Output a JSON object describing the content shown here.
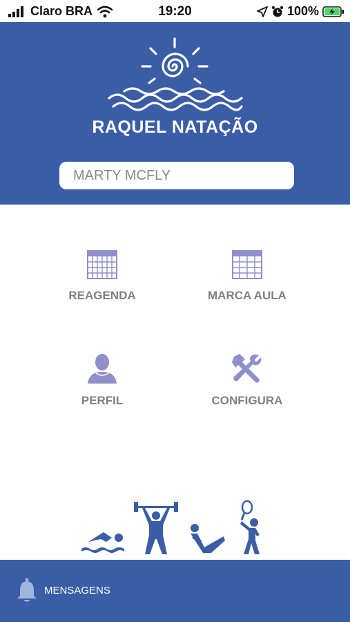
{
  "status_bar": {
    "carrier": "Claro BRA",
    "time": "19:20",
    "battery": "100%"
  },
  "header": {
    "brand": "RAQUEL NATAÇÃO",
    "student_name": "MARTY MCFLY"
  },
  "menu": {
    "items": [
      {
        "label": "REAGENDA",
        "icon": "calendar-icon"
      },
      {
        "label": "MARCA AULA",
        "icon": "grid-calendar-icon"
      },
      {
        "label": "PERFIL",
        "icon": "user-icon"
      },
      {
        "label": "CONFIGURA",
        "icon": "tools-icon"
      }
    ]
  },
  "footer": {
    "messages_label": "MENSAGENS"
  },
  "colors": {
    "brand_blue": "#3a5da6",
    "icon_lavender": "#8f8fc9",
    "label_gray": "#808080"
  }
}
